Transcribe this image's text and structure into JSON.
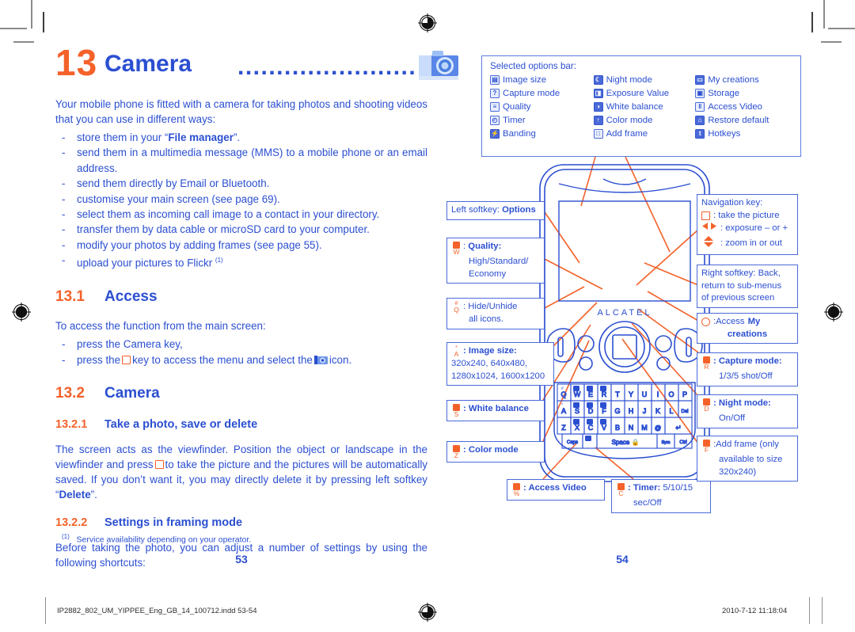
{
  "chapter": {
    "number": "13",
    "title": "Camera",
    "dots": "........................",
    "icon": "camera-icon"
  },
  "intro": {
    "paragraph": "Your mobile phone is fitted with a camera for taking photos and shooting videos that you can use in different ways:",
    "bullets": [
      "store them in your “File manager”.",
      "send them in a multimedia message (MMS) to a mobile phone or an email address.",
      "send them directly by Email or Bluetooth.",
      "customise your main screen (see page 69).",
      "select them as incoming call image to a contact in your directory.",
      "transfer them by data cable or microSD card to your computer.",
      "modify your photos by adding frames (see page 55).",
      "upload your pictures to Flickr"
    ],
    "bullet_bold": "File manager",
    "flickr_footnote_mark": "(1)"
  },
  "section_access": {
    "number": "13.1",
    "title": "Access",
    "lead": "To access the function from the main screen:",
    "steps_pre": "press the Camera key,",
    "step2_a": "press the",
    "step2_b": "key to access the menu and select the",
    "step2_c": "icon."
  },
  "section_camera": {
    "number": "13.2",
    "title": "Camera",
    "sub1": {
      "number": "13.2.1",
      "title": "Take a photo, save or delete"
    },
    "sub1_text_a": "The screen acts as the viewfinder. Position the object or landscape in the viewfinder and press",
    "sub1_text_b": "to take the picture and the pictures will be automatically saved. If you don’t want it, you may directly delete it by pressing left softkey “",
    "sub1_bold": "Delete",
    "sub1_text_c": "”.",
    "sub2": {
      "number": "13.2.2",
      "title": "Settings in framing mode"
    },
    "sub2_text": "Before taking the photo, you can adjust a number of settings by using the following shortcuts:"
  },
  "footnote": {
    "mark": "(1)",
    "text": "Service availability depending on your operator."
  },
  "page_numbers": {
    "left": "53",
    "right": "54"
  },
  "options_bar": {
    "title": "Selected options bar:",
    "column1": [
      {
        "label": "Image size",
        "icon": "image-size-icon",
        "glyph": "▤"
      },
      {
        "label": "Capture mode",
        "icon": "capture-mode-icon",
        "glyph": "?"
      },
      {
        "label": "Quality",
        "icon": "quality-icon",
        "glyph": "≡"
      },
      {
        "label": "Timer",
        "icon": "timer-icon",
        "glyph": "◴"
      },
      {
        "label": "Banding",
        "icon": "banding-icon",
        "glyph": "⚡"
      }
    ],
    "column2": [
      {
        "label": "Night mode",
        "icon": "night-mode-icon",
        "glyph": "☾"
      },
      {
        "label": "Exposure Value",
        "icon": "exposure-value-icon",
        "glyph": "◨"
      },
      {
        "label": "White balance",
        "icon": "white-balance-icon",
        "glyph": "◑"
      },
      {
        "label": "Color mode",
        "icon": "color-mode-icon",
        "glyph": "↑"
      },
      {
        "label": "Add frame",
        "icon": "add-frame-icon",
        "glyph": "□"
      }
    ],
    "column3": [
      {
        "label": "My creations",
        "icon": "my-creations-icon",
        "glyph": "▭"
      },
      {
        "label": "Storage",
        "icon": "storage-icon",
        "glyph": "▣"
      },
      {
        "label": "Access Video",
        "icon": "access-video-icon",
        "glyph": "‖"
      },
      {
        "label": "Restore default",
        "icon": "restore-default-icon",
        "glyph": "⌂"
      },
      {
        "label": "Hotkeys",
        "icon": "hotkeys-icon",
        "glyph": "t"
      }
    ]
  },
  "callouts": {
    "left_softkey": {
      "prefix": "Left softkey:",
      "bold": "Options"
    },
    "quality": {
      "key_letter": "W",
      "label": "Quality:",
      "detail1": "High/Standard/",
      "detail2": "Economy"
    },
    "hide_unhide": {
      "key_letter": "Q",
      "label": ": Hide/Unhide",
      "detail1": "all icons."
    },
    "image_size": {
      "key_letter": "A",
      "label": ": Image size:",
      "detail1": "320x240, 640x480,",
      "detail2": "1280x1024, 1600x1200"
    },
    "white_balance": {
      "key_letter": "S",
      "label": ": White balance"
    },
    "color_mode": {
      "key_letter": "Z",
      "label": ": Color mode"
    },
    "access_video": {
      "key_letter": "%",
      "label": ": Access Video"
    },
    "timer": {
      "key_letter": "C",
      "label": ": Timer:",
      "value": "5/10/15",
      "detail2": "sec/Off"
    },
    "navigation": {
      "title": "Navigation key:",
      "row1": ": take the picture",
      "row2": ": exposure – or +",
      "row3": ": zoom in or out"
    },
    "right_softkey": {
      "line1": "Right softkey: Back,",
      "line2": "return to sub-menus",
      "line3": "of previous screen"
    },
    "my_creations": {
      "prefix": ":Access",
      "bold": "My",
      "bold2": "creations"
    },
    "capture_mode": {
      "key_letter": "R",
      "label": ": Capture mode:",
      "detail1": "1/3/5 shot/Off"
    },
    "night_mode": {
      "key_letter": "D",
      "label": ": Night mode:",
      "detail1": "On/Off"
    },
    "add_frame": {
      "key_letter": "F",
      "label": ":Add frame (only",
      "detail1": "available to size",
      "detail2": "320x240)"
    }
  },
  "phone": {
    "brand": "ALCATEL",
    "keyboard_row1": [
      "Q",
      "W",
      "E",
      "R",
      "T",
      "Y",
      "U",
      "I",
      "O",
      "P"
    ],
    "keyboard_row2": [
      "A",
      "S",
      "D",
      "F",
      "G",
      "H",
      "J",
      "K",
      "L",
      "Del"
    ],
    "keyboard_row3": [
      "Z",
      "X",
      "C",
      "V",
      "B",
      "N",
      "M",
      "@",
      "↵"
    ],
    "keyboard_row4": [
      "Caps",
      "Space",
      "Sym",
      "Ctrl"
    ],
    "key_symbols_row1": [
      "#",
      "",
      "",
      "",
      "(",
      ")",
      "",
      "-",
      "+",
      ""
    ],
    "space_label": "Space"
  },
  "print_footer": {
    "file": "IP2882_802_UM_YIPPEE_Eng_GB_14_100712.indd   53-54",
    "timestamp": "2010-7-12   11:18:04"
  },
  "colors": {
    "orange": "#f4622a",
    "blue": "#2b4fd1",
    "box_border": "#4a6ad8",
    "leader": "#f4622a"
  }
}
